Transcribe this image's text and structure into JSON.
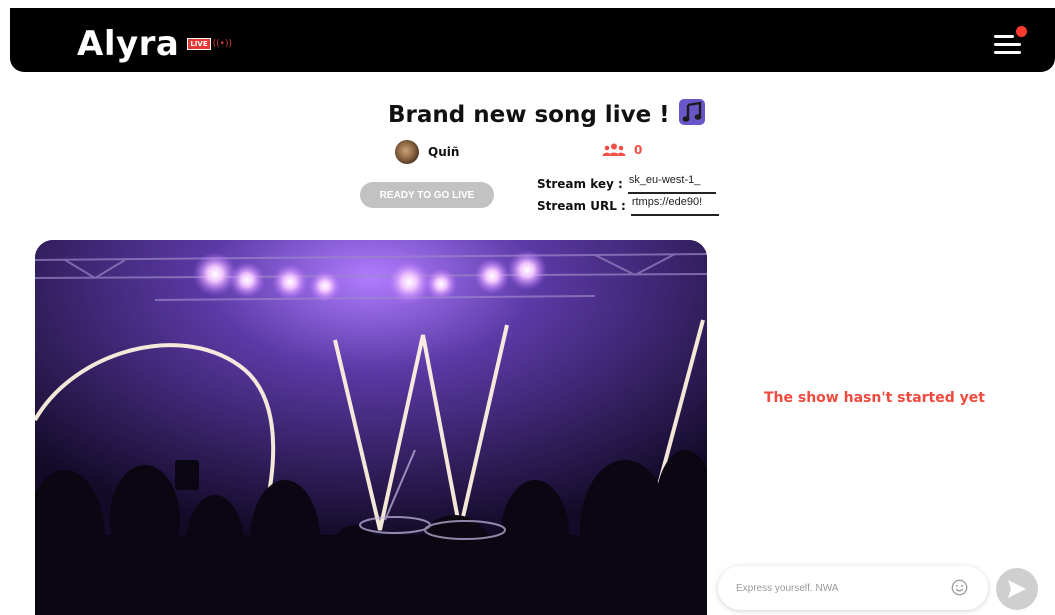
{
  "header": {
    "logo_text": "Alyra",
    "live_badge": "LIVE",
    "live_wave": "((•))",
    "menu_icon": "hamburger-menu-icon",
    "notification_dot_color": "#ff3b30"
  },
  "stream": {
    "title": "Brand new song live !",
    "title_icon": "music-note-icon",
    "author": "Quiñ",
    "viewers_icon": "users-icon",
    "viewers_count": "0",
    "go_live_label": "READY TO GO LIVE",
    "stream_key_label": "Stream key :",
    "stream_key_value": "sk_eu-west-1_",
    "stream_url_label": "Stream URL :",
    "stream_url_value": "rtmps://ede90!"
  },
  "chat": {
    "status_message": "The show hasn't started yet",
    "input_placeholder": "Express yourself. NWA",
    "emoji_icon": "smiley-icon",
    "send_icon": "send-arrow-icon"
  },
  "colors": {
    "accent": "#ef4f45",
    "header_bg": "#000000",
    "disabled_button": "#c2c2c2"
  }
}
